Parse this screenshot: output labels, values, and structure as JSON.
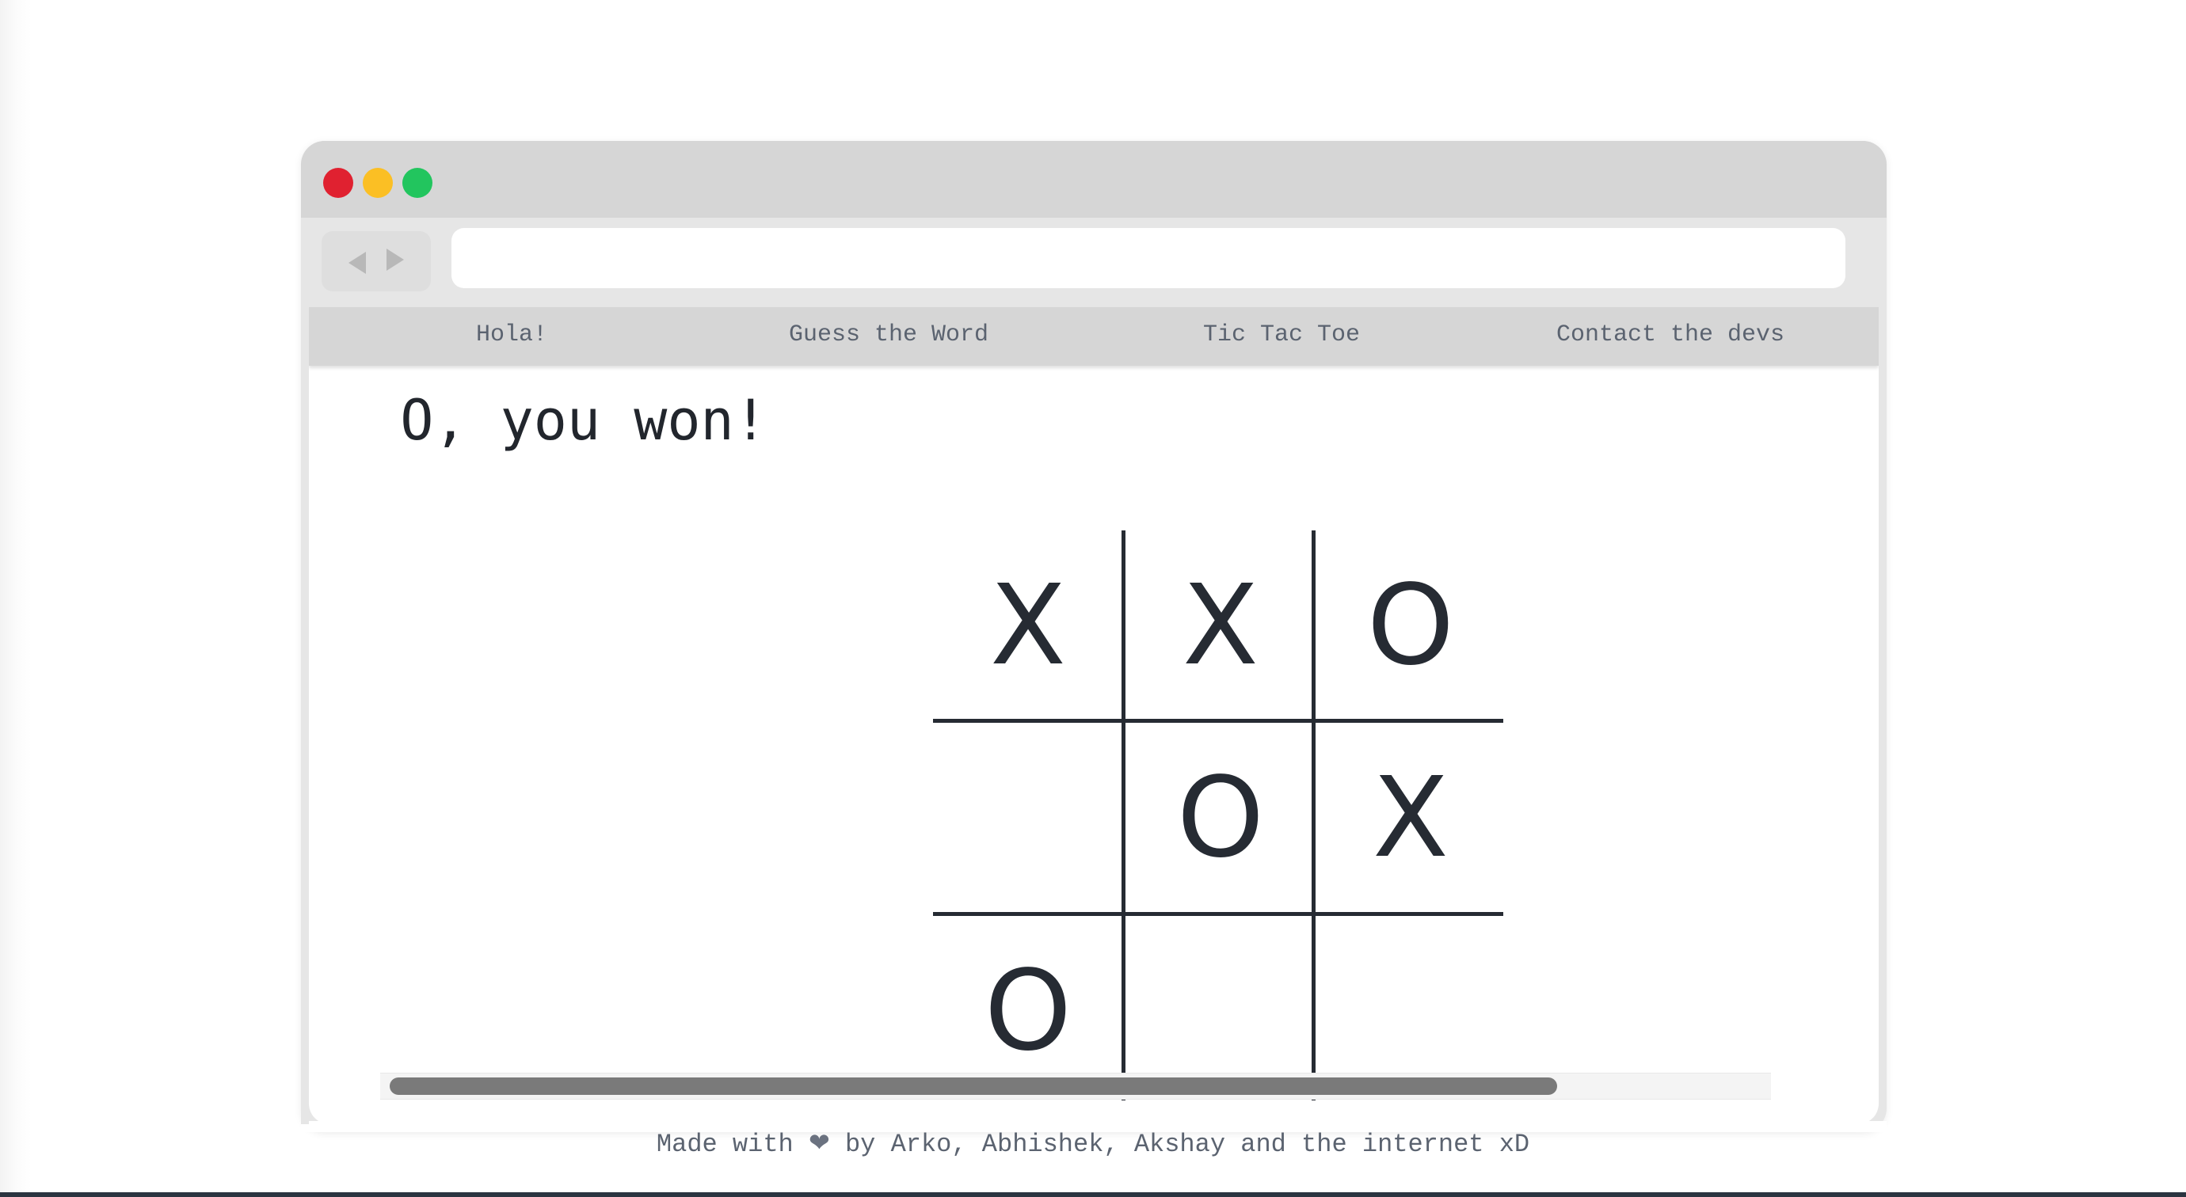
{
  "window": {
    "traffic_lights": [
      "close",
      "minimize",
      "maximize"
    ],
    "address_value": ""
  },
  "navbar": {
    "items": [
      {
        "label": "Hola!"
      },
      {
        "label": "Guess the Word"
      },
      {
        "label": "Tic Tac Toe"
      },
      {
        "label": "Contact the devs"
      }
    ]
  },
  "game": {
    "status": "O, you won!",
    "board": [
      [
        "X",
        "X",
        "O"
      ],
      [
        "",
        "O",
        "X"
      ],
      [
        "O",
        "",
        ""
      ]
    ]
  },
  "footer": {
    "prefix": "Made with",
    "heart_icon": "heart-icon",
    "suffix": "by Arko, Abhishek, Akshay and the internet xD"
  },
  "colors": {
    "close": "#e02130",
    "minimize": "#fbbf24",
    "maximize": "#22c55e",
    "board_lines": "#262b33"
  }
}
